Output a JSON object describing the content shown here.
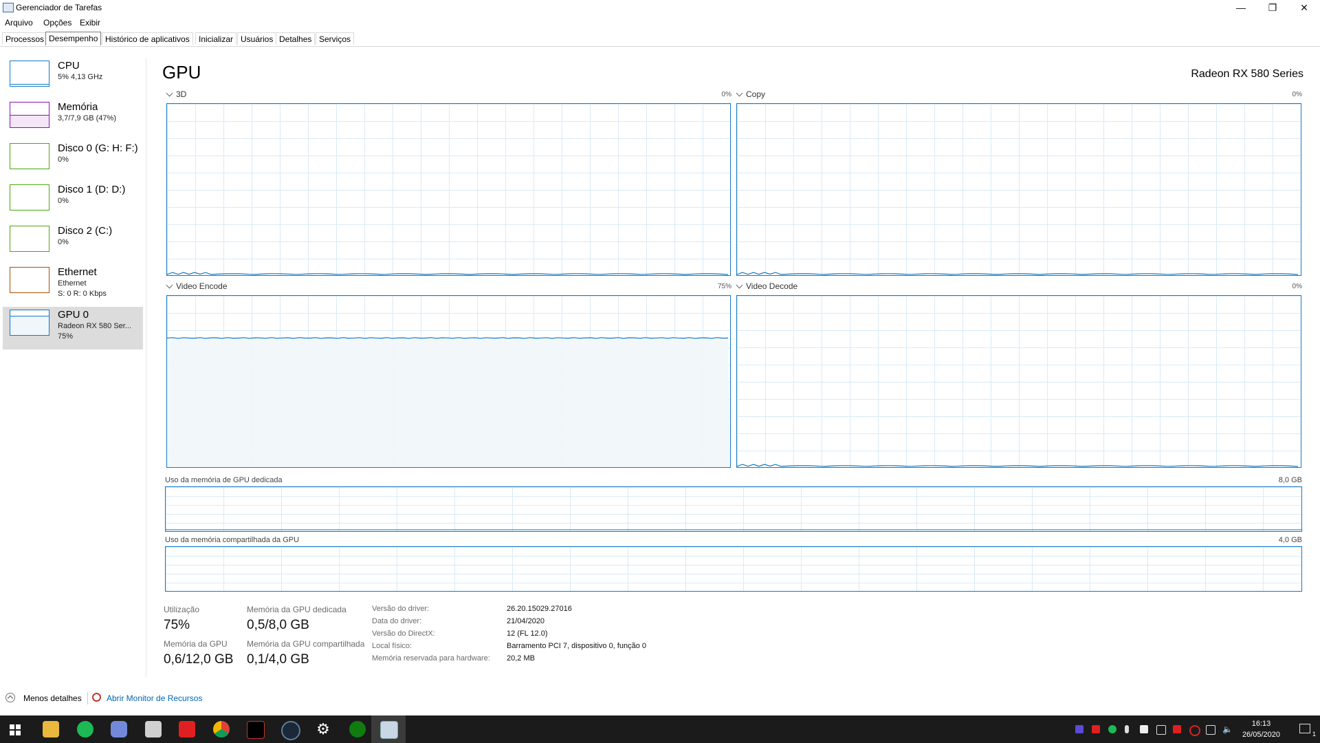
{
  "window": {
    "title": "Gerenciador de Tarefas",
    "minimize_glyph": "—",
    "maximize_glyph": "❐",
    "close_glyph": "✕"
  },
  "menu": [
    "Arquivo",
    "Opções",
    "Exibir"
  ],
  "tabs": [
    "Processos",
    "Desempenho",
    "Histórico de aplicativos",
    "Inicializar",
    "Usuários",
    "Detalhes",
    "Serviços"
  ],
  "active_tab": "Desempenho",
  "sidebar": [
    {
      "name": "CPU",
      "sub": "5% 4,13 GHz",
      "sub2": "",
      "color": "#1279c6",
      "fill": "#ffffff",
      "level": 0.05
    },
    {
      "name": "Memória",
      "sub": "3,7/7,9 GB (47%)",
      "sub2": "",
      "color": "#8b12ae",
      "fill": "#f4e5f7",
      "level": 0.47
    },
    {
      "name": "Disco 0 (G: H: F:)",
      "sub": "0%",
      "sub2": "",
      "color": "#4da60c",
      "fill": "#ffffff",
      "level": 0
    },
    {
      "name": "Disco 1 (D: D:)",
      "sub": "0%",
      "sub2": "",
      "color": "#4da60c",
      "fill": "#ffffff",
      "level": 0
    },
    {
      "name": "Disco 2 (C:)",
      "sub": "0%",
      "sub2": "",
      "color": "#4da60c",
      "fill": "#ffffff",
      "level": 0
    },
    {
      "name": "Ethernet",
      "sub": "Ethernet",
      "sub2": "S: 0 R: 0 Kbps",
      "color": "#a74f01",
      "fill": "#ffffff",
      "level": 0
    },
    {
      "name": "GPU 0",
      "sub": "Radeon RX 580 Ser...",
      "sub2": "75%",
      "color": "#1279c6",
      "fill": "#f1f6fa",
      "level": 0.75
    }
  ],
  "main": {
    "title": "GPU",
    "model": "Radeon RX 580 Series",
    "engines": [
      {
        "label": "3D",
        "percent": "0%",
        "level": 0.0
      },
      {
        "label": "Copy",
        "percent": "0%",
        "level": 0.0
      },
      {
        "label": "Video Encode",
        "percent": "75%",
        "level": 0.75
      },
      {
        "label": "Video Decode",
        "percent": "0%",
        "level": 0.0
      }
    ],
    "dedicated_label": "Uso da memória de GPU dedicada",
    "dedicated_max": "8,0 GB",
    "shared_label": "Uso da memória compartilhada da GPU",
    "shared_max": "4,0 GB",
    "stats": {
      "utilization_label": "Utilização",
      "utilization": "75%",
      "dedicated_label": "Memória da GPU dedicada",
      "dedicated": "0,5/8,0 GB",
      "gpu_mem_label": "Memória da GPU",
      "gpu_mem": "0,6/12,0 GB",
      "shared_label": "Memória da GPU compartilhada",
      "shared": "0,1/4,0 GB"
    },
    "info": [
      {
        "label": "Versão do driver:",
        "value": "26.20.15029.27016"
      },
      {
        "label": "Data do driver:",
        "value": "21/04/2020"
      },
      {
        "label": "Versão do DirectX:",
        "value": "12 (FL 12.0)"
      },
      {
        "label": "Local físico:",
        "value": "Barramento PCI 7, dispositivo 0, função 0"
      },
      {
        "label": "Memória reservada para hardware:",
        "value": "20,2 MB"
      }
    ]
  },
  "footer": {
    "less_details": "Menos detalhes",
    "resource_monitor": "Abrir Monitor de Recursos"
  },
  "taskbar": {
    "time": "16:13",
    "date": "26/05/2020",
    "notification_count": "1",
    "icons": [
      "windows-start-icon",
      "file-explorer-icon",
      "spotify-icon",
      "discord-icon",
      "calculator-icon",
      "flash-icon",
      "chrome-icon",
      "amd-radeon-icon",
      "steam-icon",
      "settings-icon",
      "xbox-icon",
      "task-manager-icon"
    ]
  }
}
